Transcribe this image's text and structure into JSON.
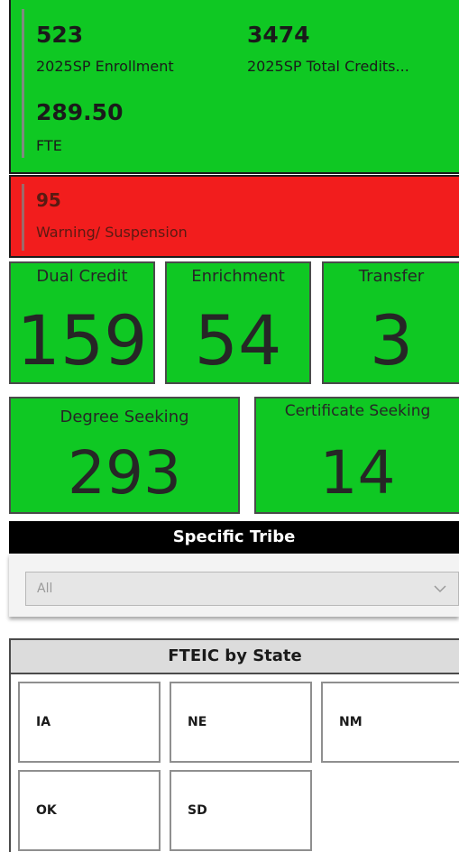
{
  "kpis": {
    "enrollment_value": "523",
    "enrollment_label": "2025SP Enrollment",
    "credits_value": "3474",
    "credits_label": "2025SP Total Credits...",
    "fte_value": "289.50",
    "fte_label": "FTE",
    "warning_value": "95",
    "warning_label": "Warning/ Suspension"
  },
  "tiles": {
    "dual_credit": {
      "title": "Dual Credit",
      "value": "159"
    },
    "enrichment": {
      "title": "Enrichment",
      "value": "54"
    },
    "transfer": {
      "title": "Transfer",
      "value": "3"
    },
    "degree_seeking": {
      "title": "Degree Seeking",
      "value": "293"
    },
    "certificate_seeking": {
      "title": "Certificate Seeking",
      "value": "14"
    }
  },
  "slicer": {
    "title": "Specific Tribe",
    "selected": "All"
  },
  "fteic": {
    "title": "FTEIC by State",
    "states": [
      "IA",
      "NE",
      "NM",
      "OK",
      "SD"
    ]
  },
  "colors": {
    "green": "#0fc823",
    "red": "#f21d1d"
  }
}
